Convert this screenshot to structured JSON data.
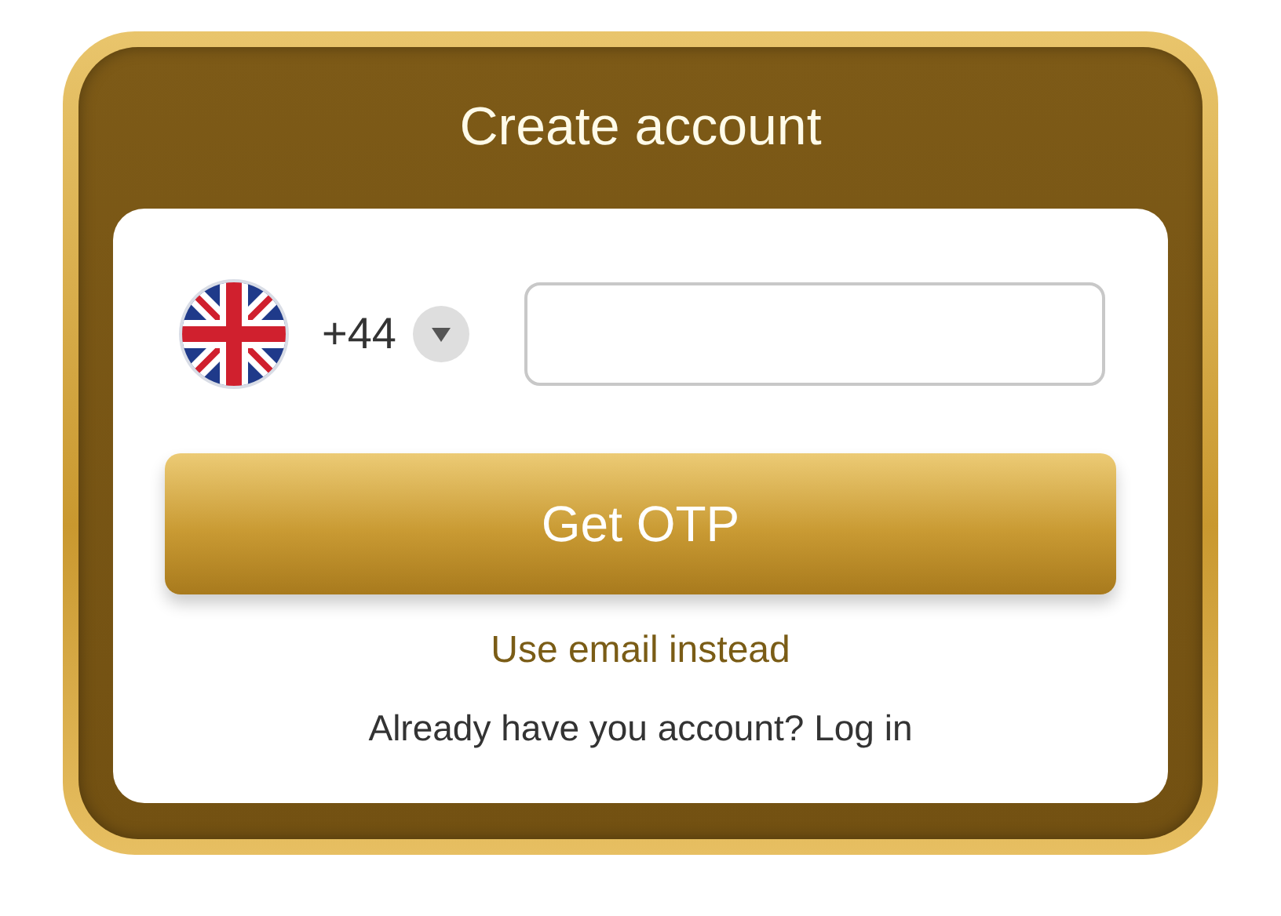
{
  "title": "Create account",
  "phone": {
    "country_code": "+44"
  },
  "submit": {
    "label": "Get OTP"
  },
  "alternate_link": "Use email instead",
  "login": {
    "prompt": "Already have you account?",
    "link": "Log in"
  }
}
